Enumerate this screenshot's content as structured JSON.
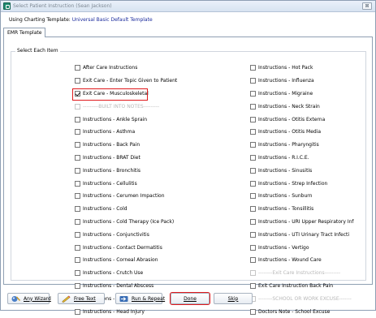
{
  "window": {
    "title": "Select Patient Instruction (Sean Jackson)",
    "close_glyph": "⊠"
  },
  "template": {
    "label": "Using Charting Template:",
    "value": "Universal Basic Default Template"
  },
  "tabs": [
    {
      "label": "EMR Template",
      "active": true
    }
  ],
  "group": {
    "title": "Select Each Item"
  },
  "left_items": [
    {
      "label": "After Care Instructions",
      "checked": false,
      "disabled": false
    },
    {
      "label": "Exit Care - Enter Topic Given to Patient",
      "checked": false,
      "disabled": false
    },
    {
      "label": "Exit Care - Musculoskeletal",
      "checked": true,
      "disabled": false
    },
    {
      "label": "---------BUILT INTO NOTES---------",
      "checked": false,
      "disabled": true
    },
    {
      "label": "Instructions - Ankle Sprain",
      "checked": false,
      "disabled": false
    },
    {
      "label": "Instructions - Asthma",
      "checked": false,
      "disabled": false
    },
    {
      "label": "Instructions - Back Pain",
      "checked": false,
      "disabled": false
    },
    {
      "label": "Instructions - BRAT Diet",
      "checked": false,
      "disabled": false
    },
    {
      "label": "Instructions - Bronchitis",
      "checked": false,
      "disabled": false
    },
    {
      "label": "Instructions - Cellulitis",
      "checked": false,
      "disabled": false
    },
    {
      "label": "Instructions - Cerumen Impaction",
      "checked": false,
      "disabled": false
    },
    {
      "label": "Instructions - Cold",
      "checked": false,
      "disabled": false
    },
    {
      "label": "Instructions - Cold Therapy (Ice Pack)",
      "checked": false,
      "disabled": false
    },
    {
      "label": "Instructions - Conjunctivitis",
      "checked": false,
      "disabled": false
    },
    {
      "label": "Instructions - Contact Dermatitis",
      "checked": false,
      "disabled": false
    },
    {
      "label": "Instructions - Corneal Abrasion",
      "checked": false,
      "disabled": false
    },
    {
      "label": "Instructions - Crutch Use",
      "checked": false,
      "disabled": false
    },
    {
      "label": "Instructions - Dental Abscess",
      "checked": false,
      "disabled": false
    },
    {
      "label": "Instructions - Fever",
      "checked": false,
      "disabled": false
    },
    {
      "label": "Instructions - Head Injury",
      "checked": false,
      "disabled": false
    }
  ],
  "right_items": [
    {
      "label": "Instructions - Hot Pack",
      "checked": false,
      "disabled": false
    },
    {
      "label": "Instructions - Influenza",
      "checked": false,
      "disabled": false
    },
    {
      "label": "Instructions - Migraine",
      "checked": false,
      "disabled": false
    },
    {
      "label": "Instructions - Neck Strain",
      "checked": false,
      "disabled": false
    },
    {
      "label": "Instructions - Otitis Externa",
      "checked": false,
      "disabled": false
    },
    {
      "label": "Instructions - Otitis Media",
      "checked": false,
      "disabled": false
    },
    {
      "label": "Instructions - Pharyngitis",
      "checked": false,
      "disabled": false
    },
    {
      "label": "Instructions - R.I.C.E.",
      "checked": false,
      "disabled": false
    },
    {
      "label": "Instructions - Sinusitis",
      "checked": false,
      "disabled": false
    },
    {
      "label": "Instructions - Strep Infection",
      "checked": false,
      "disabled": false
    },
    {
      "label": "Instructions - Sunburn",
      "checked": false,
      "disabled": false
    },
    {
      "label": "Instructions - Tonsillitis",
      "checked": false,
      "disabled": false
    },
    {
      "label": "Instructions - URI Upper Respiratory Inf",
      "checked": false,
      "disabled": false
    },
    {
      "label": "Instructions - UTI Urinary Tract Infecti",
      "checked": false,
      "disabled": false
    },
    {
      "label": "Instructions - Vertigo",
      "checked": false,
      "disabled": false
    },
    {
      "label": "Instructions - Wound Care",
      "checked": false,
      "disabled": false
    },
    {
      "label": "--------Exit Care Instructions---------",
      "checked": false,
      "disabled": true
    },
    {
      "label": "Exit Care  Instruction Back Pain",
      "checked": false,
      "disabled": false
    },
    {
      "label": "--------SCHOOL OR WORK EXCUSE-------",
      "checked": false,
      "disabled": true
    },
    {
      "label": "Doctors Note - School Excuse",
      "checked": false,
      "disabled": false
    }
  ],
  "buttons": {
    "wizard": {
      "label": "Any Wizard",
      "icon": "wizard-icon"
    },
    "free_text": {
      "label": "Free Text",
      "icon": "pencil-icon"
    },
    "run_repeat": {
      "label": "Run & Repeat",
      "icon": "run-repeat-icon"
    },
    "done": {
      "label": "Done",
      "highlighted": true
    },
    "skip": {
      "label": "Skip"
    }
  },
  "colors": {
    "highlight_border": "#e0191c",
    "template_value": "#1a2a9c",
    "titlebar_text": "#7d8893"
  }
}
